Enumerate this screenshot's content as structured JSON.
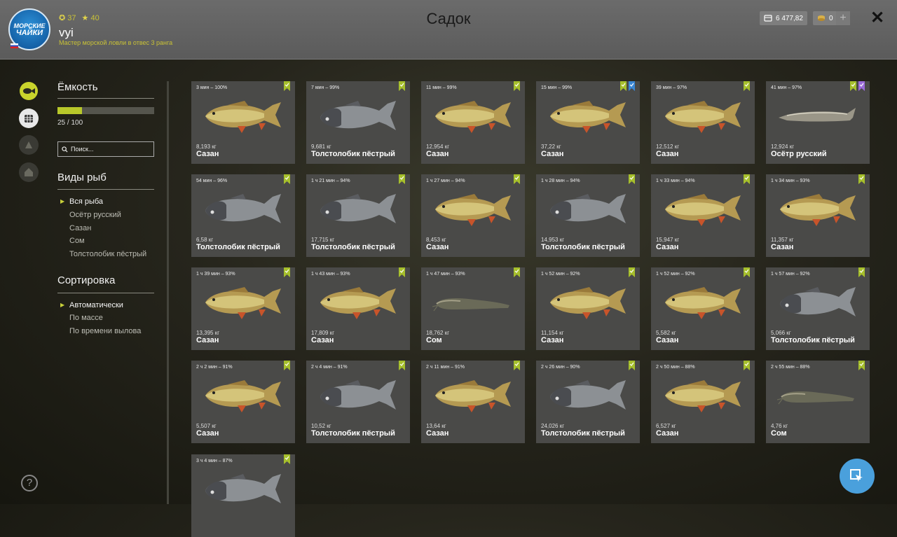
{
  "header": {
    "title": "Садок",
    "logo": {
      "line1": "МОРСКИЕ",
      "line2": "ЧАЙКИ"
    },
    "stats": {
      "level": "37",
      "stars": "40"
    },
    "username": "vyi",
    "rank": "Мастер морской ловли в отвес 3 ранга",
    "money": "6 477,82",
    "gold": "0"
  },
  "capacity": {
    "title": "Ёмкость",
    "text": "25 / 100",
    "fraction": 0.25
  },
  "search": {
    "placeholder": "Поиск..."
  },
  "species": {
    "title": "Виды рыб",
    "items": [
      "Вся рыба",
      "Осётр русский",
      "Сазан",
      "Сом",
      "Толстолобик пёстрый"
    ]
  },
  "sorting": {
    "title": "Сортировка",
    "items": [
      "Автоматически",
      "По массе",
      "По времени вылова"
    ]
  },
  "colors": {
    "accent": "#b8c82a",
    "tag_green": "#a6bf2c",
    "tag_blue": "#3a86d4",
    "tag_purple": "#9a6bd8"
  },
  "fish": [
    {
      "time": "3 мин – 100%",
      "weight": "8,193 кг",
      "name": "Сазан",
      "kind": "carp",
      "tags": [
        "green"
      ]
    },
    {
      "time": "7 мин – 99%",
      "weight": "9,681 кг",
      "name": "Толстолобик пёстрый",
      "kind": "bighead",
      "tags": [
        "green"
      ]
    },
    {
      "time": "11 мин – 99%",
      "weight": "12,954 кг",
      "name": "Сазан",
      "kind": "carp",
      "tags": [
        "green"
      ]
    },
    {
      "time": "15 мин – 99%",
      "weight": "37,22 кг",
      "name": "Сазан",
      "kind": "carp",
      "tags": [
        "green",
        "blue"
      ]
    },
    {
      "time": "39 мин – 97%",
      "weight": "12,512 кг",
      "name": "Сазан",
      "kind": "carp",
      "tags": [
        "green"
      ]
    },
    {
      "time": "41 мин – 97%",
      "weight": "12,924 кг",
      "name": "Осётр русский",
      "kind": "sturgeon",
      "tags": [
        "green",
        "purple"
      ]
    },
    {
      "time": "54 мин – 96%",
      "weight": "6,58 кг",
      "name": "Толстолобик пёстрый",
      "kind": "bighead",
      "tags": [
        "green"
      ]
    },
    {
      "time": "1 ч 21 мин – 94%",
      "weight": "17,715 кг",
      "name": "Толстолобик пёстрый",
      "kind": "bighead",
      "tags": [
        "green"
      ]
    },
    {
      "time": "1 ч 27 мин – 94%",
      "weight": "8,453 кг",
      "name": "Сазан",
      "kind": "carp",
      "tags": [
        "green"
      ]
    },
    {
      "time": "1 ч 28 мин – 94%",
      "weight": "14,953 кг",
      "name": "Толстолобик пёстрый",
      "kind": "bighead",
      "tags": [
        "green"
      ]
    },
    {
      "time": "1 ч 33 мин – 94%",
      "weight": "15,947 кг",
      "name": "Сазан",
      "kind": "carp",
      "tags": [
        "green"
      ]
    },
    {
      "time": "1 ч 34 мин – 93%",
      "weight": "11,357 кг",
      "name": "Сазан",
      "kind": "carp",
      "tags": [
        "green"
      ]
    },
    {
      "time": "1 ч 39 мин – 93%",
      "weight": "13,395 кг",
      "name": "Сазан",
      "kind": "carp",
      "tags": [
        "green"
      ]
    },
    {
      "time": "1 ч 43 мин – 93%",
      "weight": "17,809 кг",
      "name": "Сазан",
      "kind": "carp",
      "tags": [
        "green"
      ]
    },
    {
      "time": "1 ч 47 мин – 93%",
      "weight": "18,762 кг",
      "name": "Сом",
      "kind": "catfish",
      "tags": [
        "green"
      ]
    },
    {
      "time": "1 ч 52 мин – 92%",
      "weight": "11,154 кг",
      "name": "Сазан",
      "kind": "carp",
      "tags": [
        "green"
      ]
    },
    {
      "time": "1 ч 52 мин – 92%",
      "weight": "5,582 кг",
      "name": "Сазан",
      "kind": "carp",
      "tags": [
        "green"
      ]
    },
    {
      "time": "1 ч 57 мин – 92%",
      "weight": "5,066 кг",
      "name": "Толстолобик пёстрый",
      "kind": "bighead",
      "tags": [
        "green"
      ]
    },
    {
      "time": "2 ч 2 мин – 91%",
      "weight": "5,507 кг",
      "name": "Сазан",
      "kind": "carp",
      "tags": [
        "green"
      ]
    },
    {
      "time": "2 ч 4 мин – 91%",
      "weight": "10,52 кг",
      "name": "Толстолобик пёстрый",
      "kind": "bighead",
      "tags": [
        "green"
      ]
    },
    {
      "time": "2 ч 11 мин – 91%",
      "weight": "13,64 кг",
      "name": "Сазан",
      "kind": "carp",
      "tags": [
        "green"
      ]
    },
    {
      "time": "2 ч 26 мин – 90%",
      "weight": "24,026 кг",
      "name": "Толстолобик пёстрый",
      "kind": "bighead",
      "tags": [
        "green"
      ]
    },
    {
      "time": "2 ч 50 мин – 88%",
      "weight": "6,527 кг",
      "name": "Сазан",
      "kind": "carp",
      "tags": [
        "green"
      ]
    },
    {
      "time": "2 ч 55 мин – 88%",
      "weight": "4,76 кг",
      "name": "Сом",
      "kind": "catfish",
      "tags": [
        "green"
      ]
    },
    {
      "time": "3 ч 4 мин – 87%",
      "weight": "",
      "name": "",
      "kind": "bighead",
      "tags": [
        "green"
      ]
    }
  ]
}
